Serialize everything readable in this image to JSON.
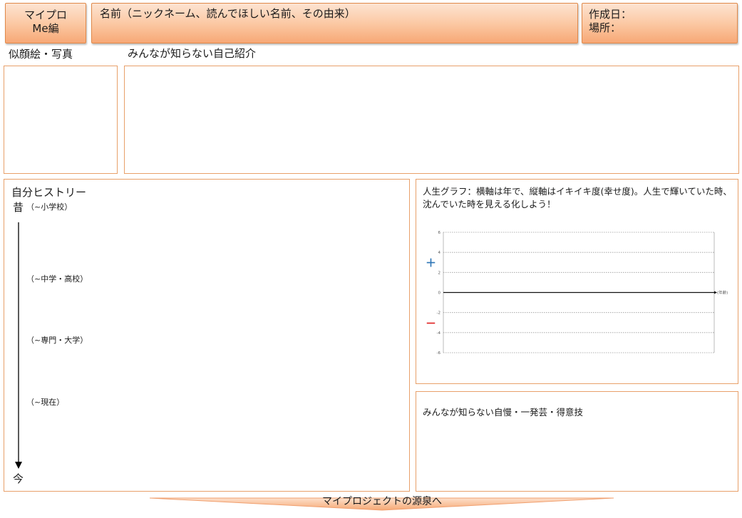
{
  "header": {
    "badge_line1": "マイプロ",
    "badge_line2": "Me編",
    "name_prompt": "名前（ニックネーム、読んでほしい名前、その由来）",
    "created_label": "作成日：",
    "place_label": "場所："
  },
  "sections": {
    "portrait_label": "似顔絵・写真",
    "intro_label": "みんなが知らない自己紹介",
    "history_title": "自分ヒストリー",
    "history_start": "昔",
    "history_end": "今",
    "stages": [
      "（~小学校）",
      "（~中学・高校）",
      "（~専門・大学）",
      "（~現在）"
    ],
    "graph_title": "人生グラフ：横軸は年で、縦軸はイキイキ度(幸せ度)。人生で輝いていた時、沈んでいた時を見える化しよう！",
    "plus_sign": "＋",
    "minus_sign": "－",
    "pride_label": "みんなが知らない自慢・一発芸・得意技"
  },
  "chart_data": {
    "type": "line",
    "x_label": "(年齢)",
    "ylim": [
      -6,
      6
    ],
    "y_ticks": [
      6,
      4,
      2,
      0,
      -2,
      -4,
      -6
    ],
    "series": [],
    "grid": true
  },
  "footer": {
    "banner": "マイプロジェクトの源泉へ"
  },
  "colors": {
    "border": "#e8a06a",
    "header_fill": "#fbc6a0",
    "plus": "#2e75b6",
    "minus": "#e02020"
  }
}
